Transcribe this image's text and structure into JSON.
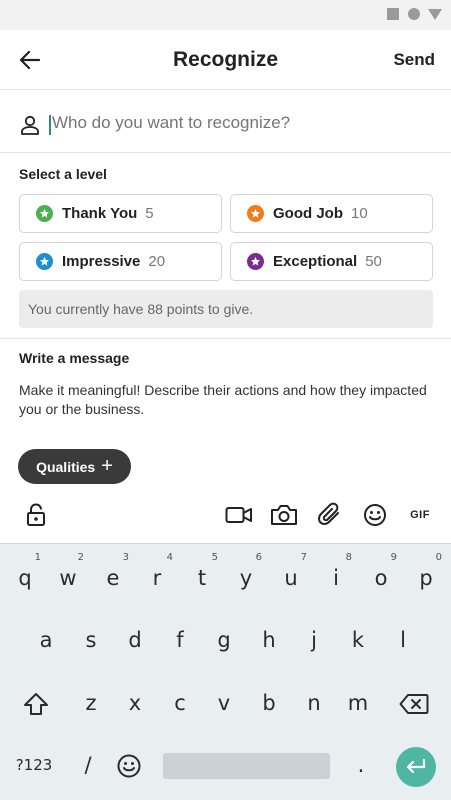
{
  "status_bar": {
    "icons": [
      "square-icon",
      "circle-icon",
      "triangle-icon"
    ]
  },
  "app_bar": {
    "back_icon": "arrow-left-icon",
    "title": "Recognize",
    "send_label": "Send"
  },
  "recipient": {
    "icon": "person-icon",
    "placeholder": "Who do you want to recognize?"
  },
  "levels": {
    "heading": "Select a level",
    "items": [
      {
        "name": "Thank You",
        "points": "5",
        "color": "#4caf50"
      },
      {
        "name": "Good Job",
        "points": "10",
        "color": "#f07c1e"
      },
      {
        "name": "Impressive",
        "points": "20",
        "color": "#1e8fd6"
      },
      {
        "name": "Exceptional",
        "points": "50",
        "color": "#7b2d8e"
      }
    ],
    "points_notice": "You currently have 88 points to give."
  },
  "message": {
    "heading": "Write a message",
    "placeholder": "Make it meaningful! Describe their actions and how they impacted you or the business."
  },
  "qualities": {
    "label": "Qualities",
    "plus": "+"
  },
  "toolbar": {
    "icons": [
      "lock-icon",
      "video-icon",
      "camera-icon",
      "paperclip-icon",
      "emoji-icon",
      "gif-icon"
    ],
    "gif_label": "GIF"
  },
  "keyboard": {
    "row1": [
      "q",
      "w",
      "e",
      "r",
      "t",
      "y",
      "u",
      "i",
      "o",
      "p"
    ],
    "row1_hints": [
      "1",
      "2",
      "3",
      "4",
      "5",
      "6",
      "7",
      "8",
      "9",
      "0"
    ],
    "row2": [
      "a",
      "s",
      "d",
      "f",
      "g",
      "h",
      "j",
      "k",
      "l"
    ],
    "row3": [
      "z",
      "x",
      "c",
      "v",
      "b",
      "n",
      "m"
    ],
    "symbols_key": "?123",
    "slash_key": "/",
    "period_key": "."
  }
}
